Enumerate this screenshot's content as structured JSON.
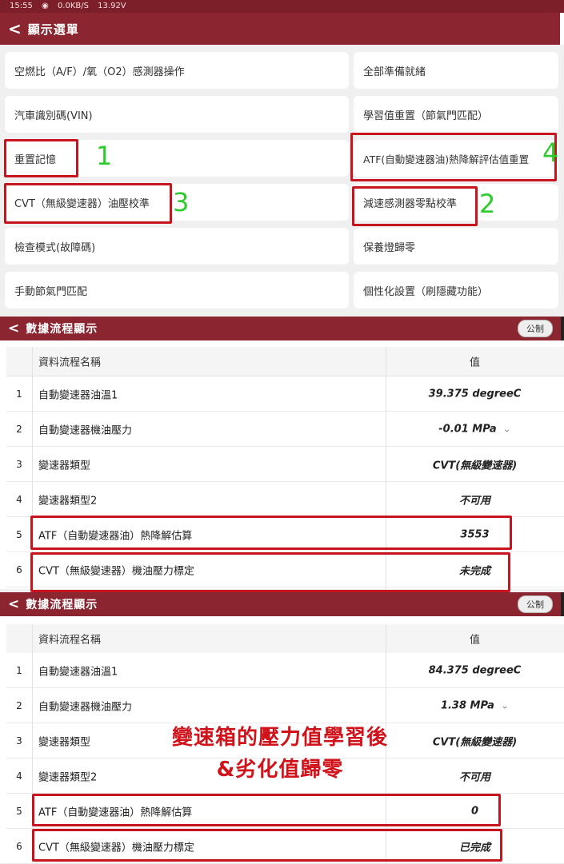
{
  "status_bar": {
    "time": "15:55",
    "net_speed": "0.0KB/S",
    "voltage": "13.92V"
  },
  "menu": {
    "title": "顯示選單",
    "left_items": [
      "空燃比（A/F）/氧（O2）感測器操作",
      "汽車識別碼(VIN)",
      "重置記憶",
      "CVT（無級變速器）油壓校準",
      "檢查模式(故障碼)",
      "手動節氣門匹配"
    ],
    "right_items": [
      "全部準備就緒",
      "學習值重置（節氣門匹配）",
      "ATF(自動變速器油)熱降解評估值重置",
      "減速感測器零點校準",
      "保養燈歸零",
      "個性化設置（刷隱藏功能）"
    ],
    "markers": [
      "1",
      "2",
      "3",
      "4"
    ]
  },
  "datastream_before": {
    "title": "數據流程顯示",
    "unit_button": "公制",
    "col_name": "資料流程名稱",
    "col_value": "值",
    "rows": [
      {
        "num": "1",
        "name": "自動變速器油溫1",
        "value": "39.375  degreeC"
      },
      {
        "num": "2",
        "name": "自動變速器機油壓力",
        "value": "-0.01  MPa"
      },
      {
        "num": "3",
        "name": "變速器類型",
        "value": "CVT(無級變速器)"
      },
      {
        "num": "4",
        "name": "變速器類型2",
        "value": "不可用"
      },
      {
        "num": "5",
        "name": "ATF（自動變速器油）熱降解估算",
        "value": "3553"
      },
      {
        "num": "6",
        "name": "CVT（無級變速器）機油壓力標定",
        "value": "未完成"
      }
    ]
  },
  "datastream_after": {
    "title": "數據流程顯示",
    "unit_button": "公制",
    "col_name": "資料流程名稱",
    "col_value": "值",
    "rows": [
      {
        "num": "1",
        "name": "自動變速器油溫1",
        "value": "84.375  degreeC"
      },
      {
        "num": "2",
        "name": "自動變速器機油壓力",
        "value": "1.38  MPa"
      },
      {
        "num": "3",
        "name": "變速器類型",
        "value": "CVT(無級變速器)"
      },
      {
        "num": "4",
        "name": "變速器類型2",
        "value": "不可用"
      },
      {
        "num": "5",
        "name": "ATF（自動變速器油）熱降解估算",
        "value": "0"
      },
      {
        "num": "6",
        "name": "CVT（無級變速器）機油壓力標定",
        "value": "已完成"
      }
    ]
  },
  "annotation": {
    "line1": "變速箱的壓力值學習後",
    "line2": "&劣化值歸零"
  },
  "colors": {
    "header": "#8b2530",
    "highlight": "#c8141e",
    "marker": "#2ccc2c"
  }
}
